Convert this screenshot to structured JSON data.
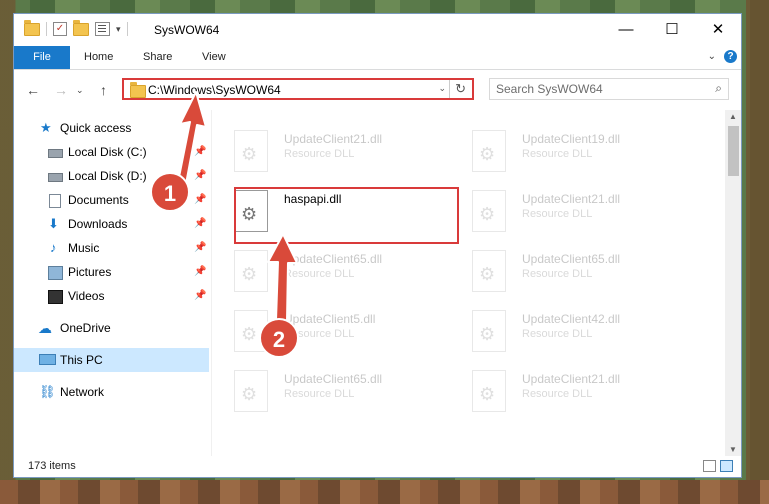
{
  "window": {
    "title": "SysWOW64",
    "controls": {
      "minimize": "—",
      "maximize": "☐",
      "close": "✕"
    }
  },
  "ribbon": {
    "tabs": [
      "File",
      "Home",
      "Share",
      "View"
    ],
    "help": "?",
    "expand": "⌄"
  },
  "navigation": {
    "back": "←",
    "forward": "→",
    "recent": "⌄",
    "up": "↑",
    "address": "C:\\Windows\\SysWOW64",
    "dropdown": "⌄",
    "refresh": "↻",
    "search_placeholder": "Search SysWOW64",
    "search_icon": "⌕"
  },
  "sidebar": {
    "items": [
      {
        "label": "Quick access",
        "icon": "star-icon",
        "glyph": "★"
      },
      {
        "label": "Local Disk (C:)",
        "icon": "disk-icon",
        "pinned": true
      },
      {
        "label": "Local Disk (D:)",
        "icon": "disk-icon",
        "pinned": true
      },
      {
        "label": "Documents",
        "icon": "documents-icon",
        "pinned": true
      },
      {
        "label": "Downloads",
        "icon": "downloads-icon",
        "glyph": "⬇",
        "pinned": true
      },
      {
        "label": "Music",
        "icon": "music-icon",
        "glyph": "♪",
        "pinned": true
      },
      {
        "label": "Pictures",
        "icon": "pictures-icon",
        "pinned": true
      },
      {
        "label": "Videos",
        "icon": "videos-icon",
        "pinned": true
      },
      {
        "label": "OneDrive",
        "icon": "cloud-icon",
        "glyph": "☁"
      },
      {
        "label": "This PC",
        "icon": "computer-icon",
        "selected": true
      },
      {
        "label": "Network",
        "icon": "network-icon",
        "glyph": "⛓"
      }
    ],
    "pin_glyph": "📌"
  },
  "files": [
    {
      "name": "UpdateClient21.dll",
      "type": "Resource DLL"
    },
    {
      "name": "UpdateClient19.dll",
      "type": "Resource DLL"
    },
    {
      "name": "haspapi.dll",
      "type": "",
      "highlighted": true
    },
    {
      "name": "UpdateClient21.dll",
      "type": "Resource DLL"
    },
    {
      "name": "UpdateClient65.dll",
      "type": "Resource DLL"
    },
    {
      "name": "UpdateClient65.dll",
      "type": "Resource DLL"
    },
    {
      "name": "UpdateClient5.dll",
      "type": "Resource DLL"
    },
    {
      "name": "UpdateClient42.dll",
      "type": "Resource DLL"
    },
    {
      "name": "UpdateClient65.dll",
      "type": "Resource DLL"
    },
    {
      "name": "UpdateClient21.dll",
      "type": "Resource DLL"
    }
  ],
  "status": {
    "item_count": "173 items"
  },
  "annotations": {
    "step1": "1",
    "step2": "2",
    "accent": "#d94a3a"
  }
}
